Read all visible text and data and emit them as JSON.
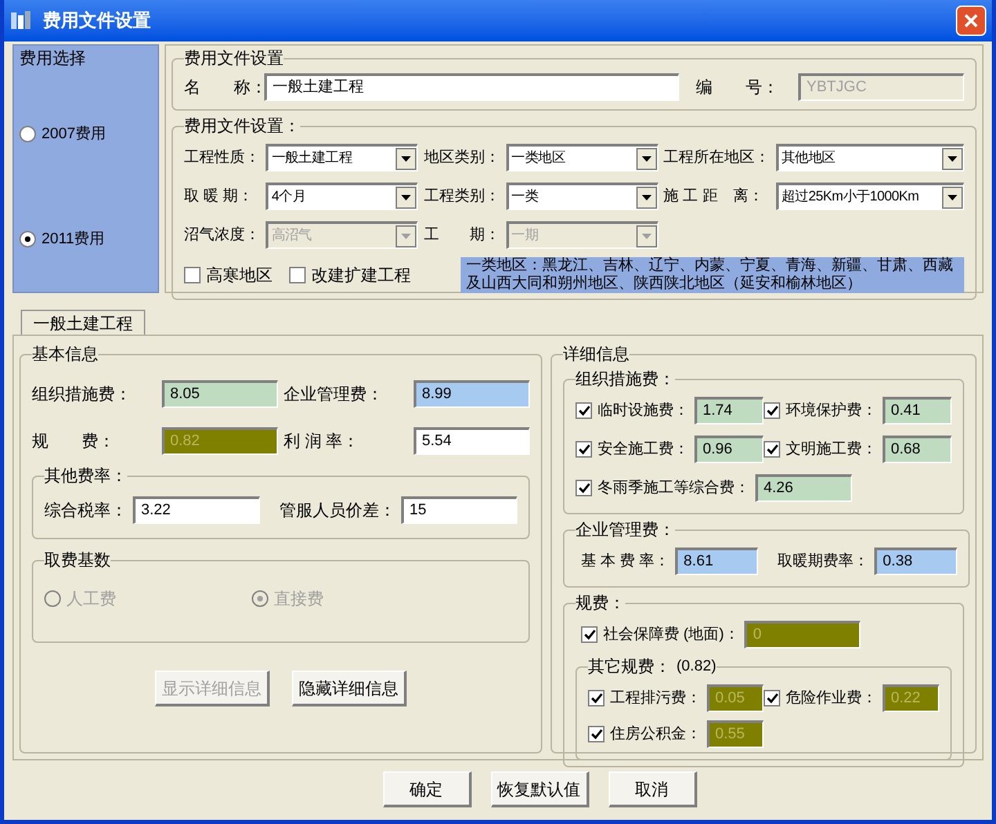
{
  "window": {
    "title": "费用文件设置"
  },
  "fee_choice": {
    "title": "费用选择",
    "options": [
      {
        "label": "2007费用",
        "selected": false
      },
      {
        "label": "2011费用",
        "selected": true
      }
    ]
  },
  "file_settings": {
    "title": "费用文件设置",
    "name": {
      "label": "名　　称：",
      "value": "一般土建工程",
      "disabled": false
    },
    "code": {
      "label": "编　　号：",
      "value": "YBTJGC",
      "disabled": true
    }
  },
  "cost_settings": {
    "title": "费用文件设置：",
    "selects": [
      {
        "label": "工程性质：",
        "value": "一般土建工程",
        "disabled": false
      },
      {
        "label": "地区类别：",
        "value": "一类地区",
        "disabled": false
      },
      {
        "label": "工程所在地区：",
        "value": "其他地区",
        "disabled": false
      },
      {
        "label": "取 暖 期：",
        "value": "4个月",
        "disabled": false
      },
      {
        "label": "工程类别：",
        "value": "一类",
        "disabled": false
      },
      {
        "label": "施 工 距　离：",
        "value": "超过25Km小于1000Km",
        "disabled": false
      },
      {
        "label": "沼气浓度：",
        "value": "高沼气",
        "disabled": true
      },
      {
        "label": "工　　期：",
        "value": "一期",
        "disabled": true
      }
    ],
    "checkboxes": [
      {
        "label": "高寒地区",
        "checked": false
      },
      {
        "label": "改建扩建工程",
        "checked": false
      }
    ],
    "note": "一类地区：黑龙江、吉林、辽宁、内蒙、宁夏、青海、新疆、甘肃、西藏及山西大同和朔州地区、陕西陕北地区（延安和榆林地区）"
  },
  "tabs": [
    {
      "label": "一般土建工程",
      "selected": true
    }
  ],
  "basic_info": {
    "title": "基本信息",
    "fields": [
      {
        "label": "组织措施费：",
        "value": "8.05",
        "color": "#c0dcc0"
      },
      {
        "label": "企业管理费：",
        "value": "8.99",
        "color": "#a6caf0"
      },
      {
        "label": "规　　费：",
        "value": "0.82",
        "color": "#808000"
      },
      {
        "label": "利 润 率：",
        "value": "5.54",
        "color": "#ffffff"
      }
    ],
    "other_rates": {
      "title": "其他费率：",
      "fields": [
        {
          "label": "综合税率：",
          "value": "3.22"
        },
        {
          "label": "管服人员价差：",
          "value": "15"
        }
      ]
    },
    "fee_base": {
      "title": "取费基数",
      "disabled": true,
      "options": [
        {
          "label": "人工费",
          "selected": false
        },
        {
          "label": "直接费",
          "selected": true
        }
      ]
    },
    "buttons": [
      {
        "label": "显示详细信息",
        "disabled": true
      },
      {
        "label": "隐藏详细信息",
        "disabled": false
      }
    ]
  },
  "detail_info": {
    "title": "详细信息",
    "org_measures": {
      "title": "组织措施费：",
      "color": "#c0dcc0",
      "items": [
        {
          "label": "临时设施费：",
          "value": "1.74",
          "checked": true
        },
        {
          "label": "环境保护费：",
          "value": "0.41",
          "checked": true
        },
        {
          "label": "安全施工费：",
          "value": "0.96",
          "checked": true
        },
        {
          "label": "文明施工费：",
          "value": "0.68",
          "checked": true
        },
        {
          "label": "冬雨季施工等综合费：",
          "value": "4.26",
          "checked": true
        }
      ]
    },
    "management": {
      "title": "企业管理费：",
      "color": "#a6caf0",
      "fields": [
        {
          "label": "基 本 费 率：",
          "value": "8.61"
        },
        {
          "label": "取暖期费率：",
          "value": "0.38"
        }
      ]
    },
    "regulatory": {
      "title": "规费：",
      "color": "#808000",
      "items": [
        {
          "label": "社会保障费 (地面)：",
          "value": "0",
          "checked": true
        }
      ],
      "other": {
        "title": "其它规费：",
        "total": "(0.82)",
        "items": [
          {
            "label": "工程排污费：",
            "value": "0.05",
            "checked": true
          },
          {
            "label": "危险作业费：",
            "value": "0.22",
            "checked": true
          },
          {
            "label": "住房公积金：",
            "value": "0.55",
            "checked": true
          }
        ]
      }
    }
  },
  "footer_buttons": [
    "确定",
    "恢复默认值",
    "取消"
  ]
}
